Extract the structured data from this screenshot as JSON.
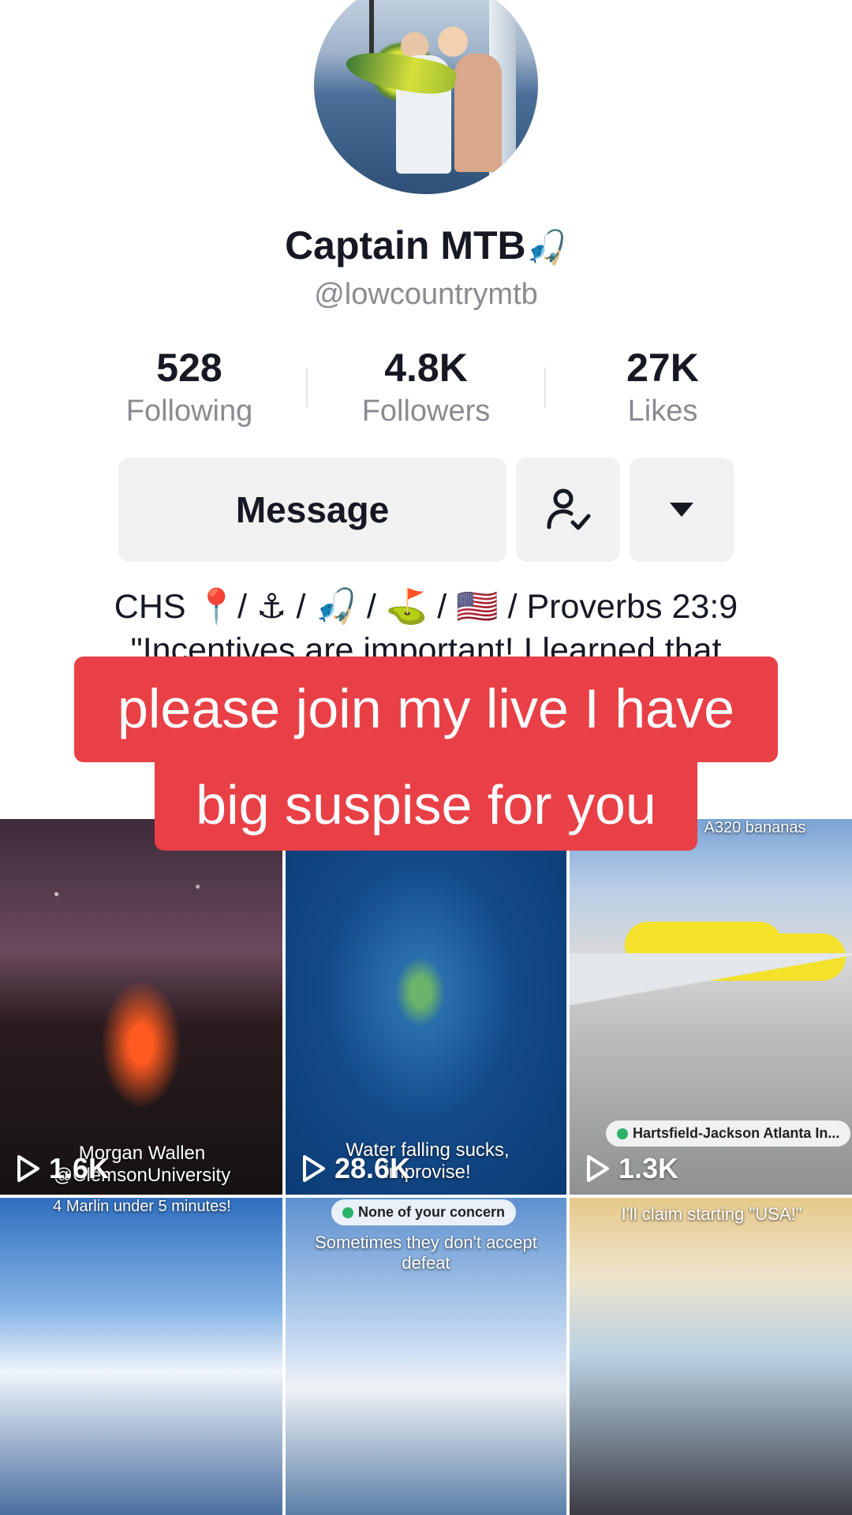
{
  "profile": {
    "display_name": "Captain MTB",
    "name_emoji": "🎣",
    "handle": "@lowcountrymtb",
    "avatar_icon": "profile-avatar"
  },
  "stats": [
    {
      "value": "528",
      "label": "Following"
    },
    {
      "value": "4.8K",
      "label": "Followers"
    },
    {
      "value": "27K",
      "label": "Likes"
    }
  ],
  "actions": {
    "message_label": "Message",
    "follow_icon": "person-check-icon",
    "more_icon": "caret-down-icon"
  },
  "bio": {
    "line1": "CHS 📍/ ⚓ / 🎣 / ⛳ / 🇺🇸 / Proverbs 23:9",
    "line2": "\"Incentives are important! I learned that"
  },
  "overlay": {
    "line1": "please join my live I have",
    "line2": "big suspise for you",
    "color": "#e84046"
  },
  "videos": [
    {
      "views": "1.6K",
      "caption": "Morgan Wallen @ClemsonUniversity"
    },
    {
      "views": "28.6K",
      "caption": "Water falling sucks, improvise!"
    },
    {
      "views": "1.3K",
      "top_caption": "A320 bananas",
      "location": "Hartsfield-Jackson Atlanta In..."
    },
    {
      "top_caption": "4 Marlin under 5 minutes!"
    },
    {
      "location": "None of your concern",
      "top_caption": "Sometimes they don't accept defeat"
    },
    {
      "top_caption": "I'll claim starting \"USA!\""
    }
  ]
}
